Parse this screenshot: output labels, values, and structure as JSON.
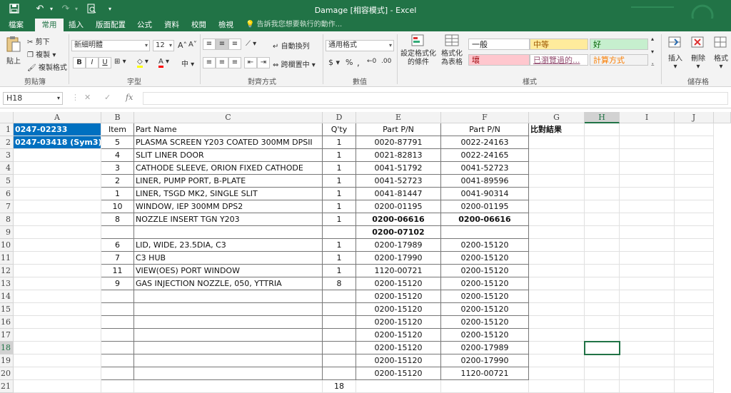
{
  "window": {
    "title": "Damage  [相容模式] - Excel"
  },
  "titlebar_icons": [
    "save-icon",
    "undo-icon",
    "redo-icon",
    "print-preview-icon",
    "customize-icon"
  ],
  "tabs": [
    "檔案",
    "常用",
    "插入",
    "版面配置",
    "公式",
    "資料",
    "校閱",
    "檢視"
  ],
  "active_tab": "常用",
  "tellme": "告訴我您想要執行的動作...",
  "ribbon": {
    "clipboard": {
      "paste": "貼上",
      "cut": "剪下",
      "copy": "複製",
      "format_painter": "複製格式",
      "label": "剪貼簿"
    },
    "font": {
      "name": "新細明體",
      "size": "12",
      "label": "字型",
      "bold": "B",
      "italic": "I",
      "underline": "U",
      "grow": "A",
      "shrink": "A",
      "phonetic": "中"
    },
    "alignment": {
      "wrap": "自動換列",
      "merge": "跨欄置中",
      "label": "對齊方式"
    },
    "number": {
      "format": "通用格式",
      "currency": "$",
      "percent": "%",
      "comma": ",",
      "label": "數值"
    },
    "styles": {
      "conditional": "設定格式化的條件",
      "as_table": "格式化為表格",
      "items": [
        {
          "label": "一般",
          "bg": "#ffffff",
          "color": "#222222"
        },
        {
          "label": "中等",
          "bg": "#ffeb9c",
          "color": "#9c5700"
        },
        {
          "label": "好",
          "bg": "#c6efce",
          "color": "#006100"
        },
        {
          "label": "壞",
          "bg": "#ffc7ce",
          "color": "#9c0006"
        },
        {
          "label": "已瀏覽過的...",
          "bg": "#ffffff",
          "color": "#954f72"
        },
        {
          "label": "計算方式",
          "bg": "#f2f2f2",
          "color": "#fa7d00"
        }
      ],
      "label": "樣式"
    },
    "cells": {
      "insert": "插入",
      "delete": "刪除",
      "format": "格式",
      "label": "儲存格"
    }
  },
  "namebox": "H18",
  "columns": [
    "A",
    "B",
    "C",
    "D",
    "E",
    "F",
    "G",
    "H",
    "I",
    "J"
  ],
  "row_numbers": [
    "1",
    "2",
    "3",
    "4",
    "5",
    "6",
    "7",
    "8",
    "9",
    "10",
    "11",
    "12",
    "13",
    "14",
    "15",
    "16",
    "17",
    "18",
    "19",
    "20",
    "21"
  ],
  "rows": [
    [
      "0247-02233",
      "Item",
      "Part Name",
      "Q'ty",
      "Part P/N",
      "Part P/N",
      "比對結果"
    ],
    [
      "0247-03418 (Sym3)",
      "5",
      "PLASMA SCREEN Y203 COATED 300MM DPSII",
      "1",
      "0020-87791",
      "0022-24163",
      ""
    ],
    [
      "",
      "4",
      "SLIT LINER DOOR",
      "1",
      "0021-82813",
      "0022-24165",
      ""
    ],
    [
      "",
      "3",
      "CATHODE SLEEVE, ORION FIXED CATHODE",
      "1",
      "0041-51792",
      "0041-52723",
      ""
    ],
    [
      "",
      "2",
      "LINER, PUMP PORT, B-PLATE",
      "1",
      "0041-52723",
      "0041-89596",
      ""
    ],
    [
      "",
      "1",
      "LINER, TSGD MK2, SINGLE SLIT",
      "1",
      "0041-81447",
      "0041-90314",
      ""
    ],
    [
      "",
      "10",
      "WINDOW, IEP 300MM DPS2",
      "1",
      "0200-01195",
      "0200-01195",
      ""
    ],
    [
      "",
      "8",
      "NOZZLE INSERT TGN Y203",
      "1",
      "0200-06616",
      "0200-06616",
      ""
    ],
    [
      "",
      "",
      "",
      "",
      "0200-07102",
      "",
      ""
    ],
    [
      "",
      "6",
      "LID, WIDE, 23.5DIA, C3",
      "1",
      "0200-17989",
      "0200-15120",
      ""
    ],
    [
      "",
      "7",
      "C3 HUB",
      "1",
      "0200-17990",
      "0200-15120",
      ""
    ],
    [
      "",
      "11",
      "VIEW(OES) PORT WINDOW",
      "1",
      "1120-00721",
      "0200-15120",
      ""
    ],
    [
      "",
      "9",
      "GAS INJECTION NOZZLE, 050, YTTRIA",
      "8",
      "0200-15120",
      "0200-15120",
      ""
    ],
    [
      "",
      "",
      "",
      "",
      "0200-15120",
      "0200-15120",
      ""
    ],
    [
      "",
      "",
      "",
      "",
      "0200-15120",
      "0200-15120",
      ""
    ],
    [
      "",
      "",
      "",
      "",
      "0200-15120",
      "0200-15120",
      ""
    ],
    [
      "",
      "",
      "",
      "",
      "0200-15120",
      "0200-15120",
      ""
    ],
    [
      "",
      "",
      "",
      "",
      "0200-15120",
      "0200-17989",
      ""
    ],
    [
      "",
      "",
      "",
      "",
      "0200-15120",
      "0200-17990",
      ""
    ],
    [
      "",
      "",
      "",
      "",
      "0200-15120",
      "1120-00721",
      ""
    ],
    [
      "",
      "",
      "",
      "18",
      "",
      "",
      ""
    ]
  ]
}
